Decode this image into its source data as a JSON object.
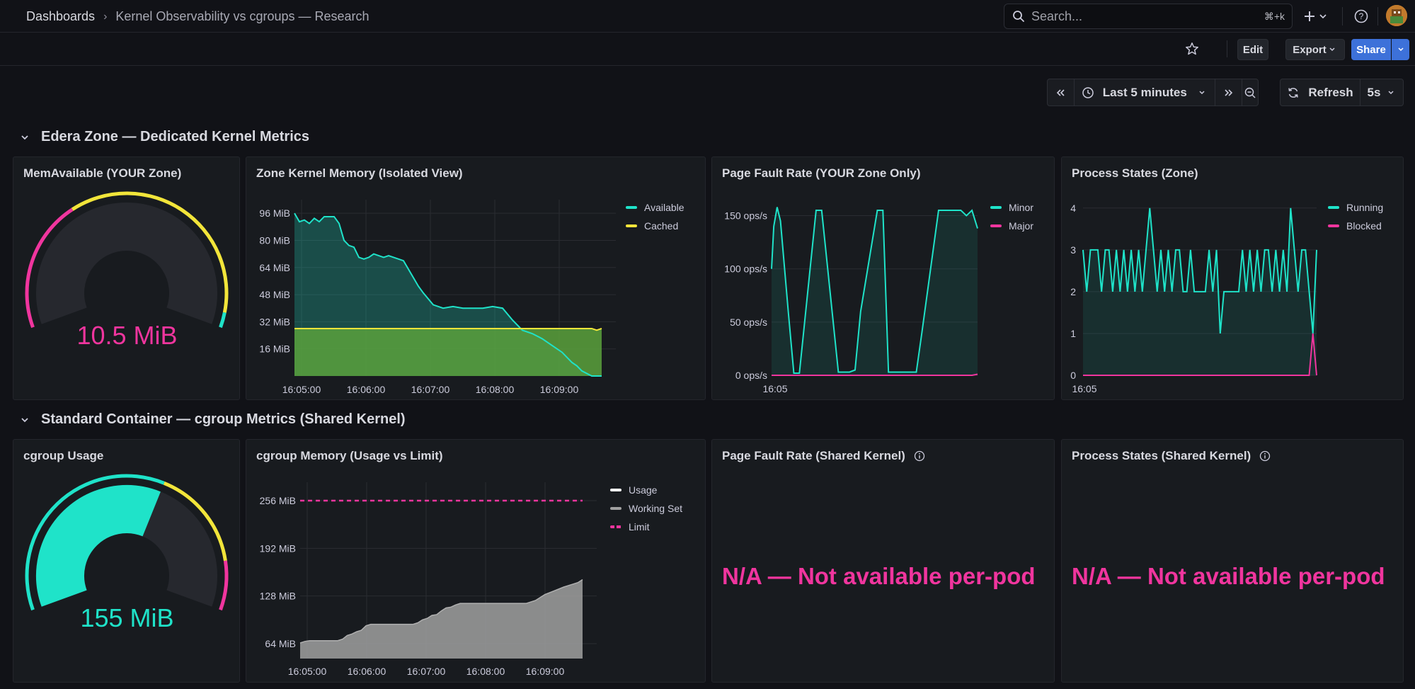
{
  "breadcrumb": {
    "home": "Dashboards",
    "separator": "›",
    "current": "Kernel Observability vs cgroups — Research"
  },
  "search": {
    "placeholder": "Search...",
    "shortcut": "⌘+k"
  },
  "toolbar": {
    "edit_label": "Edit",
    "export_label": "Export",
    "share_label": "Share"
  },
  "timepicker": {
    "range_label": "Last 5 minutes",
    "refresh_label": "Refresh",
    "interval": "5s"
  },
  "colors": {
    "accent_blue": "#3d71d9",
    "green": "#1fe3c9",
    "yellow": "#f2e53a",
    "pink": "#f0359e",
    "white": "#ffffff",
    "gray": "#a0a0a0",
    "green_fill": "#5aa13c"
  },
  "rows": [
    {
      "title": "Edera Zone — Dedicated Kernel Metrics"
    },
    {
      "title": "Standard Container — cgroup Metrics (Shared Kernel)"
    }
  ],
  "panels": {
    "mem_available": {
      "title": "MemAvailable (YOUR Zone)",
      "value": "10.5 MiB",
      "value_color": "#f0359e",
      "gauge_fraction": 0.04
    },
    "zone_kernel_memory": {
      "title": "Zone Kernel Memory (Isolated View)",
      "legend": [
        "Available",
        "Cached"
      ]
    },
    "page_fault_zone": {
      "title": "Page Fault Rate (YOUR Zone Only)",
      "legend": [
        "Minor",
        "Major"
      ]
    },
    "process_states_zone": {
      "title": "Process States (Zone)",
      "legend": [
        "Running",
        "Blocked"
      ]
    },
    "cgroup_usage": {
      "title": "cgroup Usage",
      "value": "155 MiB",
      "value_color": "#1fe3c9",
      "gauge_fraction": 0.6
    },
    "cgroup_memory": {
      "title": "cgroup Memory (Usage vs Limit)",
      "legend": [
        "Usage",
        "Working Set",
        "Limit"
      ]
    },
    "page_fault_shared": {
      "title": "Page Fault Rate (Shared Kernel)",
      "message": "N/A — Not available per-pod"
    },
    "process_states_shared": {
      "title": "Process States (Shared Kernel)",
      "message": "N/A — Not available per-pod"
    }
  },
  "chart_data": [
    {
      "id": "zone_kernel_memory",
      "type": "area",
      "x_ticks": [
        "16:05:00",
        "16:06:00",
        "16:07:00",
        "16:08:00",
        "16:09:00"
      ],
      "y_ticks": [
        "16 MiB",
        "32 MiB",
        "48 MiB",
        "64 MiB",
        "80 MiB",
        "96 MiB"
      ],
      "ylim": [
        0,
        104
      ],
      "xlim": [
        0,
        310
      ],
      "series": [
        {
          "name": "Available",
          "color": "#1fe3c9",
          "x": [
            0,
            5,
            10,
            15,
            20,
            25,
            30,
            40,
            45,
            50,
            55,
            60,
            65,
            70,
            75,
            80,
            90,
            95,
            100,
            110,
            115,
            120,
            125,
            130,
            140,
            150,
            160,
            170,
            180,
            190,
            200,
            210,
            220,
            230,
            240,
            250,
            260,
            270,
            275,
            280,
            285,
            290,
            300,
            310
          ],
          "y": [
            96,
            91,
            92,
            90,
            93,
            91,
            94,
            94,
            90,
            80,
            77,
            76,
            70,
            69,
            70,
            72,
            70,
            71,
            70,
            68,
            63,
            58,
            53,
            49,
            42,
            40,
            41,
            40,
            40,
            40,
            41,
            40,
            33,
            27,
            25,
            22,
            18,
            14,
            11,
            8,
            6,
            3,
            0,
            0
          ]
        },
        {
          "name": "Cached",
          "color": "#f2e53a",
          "x": [
            0,
            300,
            305,
            310
          ],
          "y": [
            28,
            28,
            27,
            28
          ]
        }
      ]
    },
    {
      "id": "page_fault_zone",
      "type": "line",
      "x_ticks": [
        "16:05"
      ],
      "y_ticks": [
        "0 ops/s",
        "50 ops/s",
        "100 ops/s",
        "150 ops/s"
      ],
      "ylim": [
        0,
        165
      ],
      "series": [
        {
          "name": "Minor",
          "color": "#1fe3c9",
          "x": [
            0,
            2,
            5,
            8,
            15,
            20,
            25,
            40,
            45,
            60,
            70,
            75,
            80,
            95,
            100,
            105,
            120,
            130,
            135,
            150,
            155,
            160,
            170,
            175,
            180,
            185
          ],
          "y": [
            100,
            140,
            158,
            145,
            60,
            2,
            2,
            155,
            155,
            3,
            3,
            5,
            60,
            155,
            155,
            3,
            3,
            3,
            40,
            155,
            155,
            155,
            155,
            150,
            155,
            138
          ]
        },
        {
          "name": "Major",
          "color": "#f0359e",
          "x": [
            0,
            180,
            185
          ],
          "y": [
            0,
            0,
            1
          ]
        }
      ]
    },
    {
      "id": "process_states_zone",
      "type": "line",
      "x_ticks": [
        "16:05"
      ],
      "y_ticks": [
        "0",
        "1",
        "2",
        "3",
        "4"
      ],
      "ylim": [
        0,
        4.2
      ],
      "series": [
        {
          "name": "Running",
          "color": "#1fe3c9",
          "y": [
            3,
            2,
            3,
            3,
            3,
            2,
            3,
            3,
            2,
            3,
            2,
            3,
            2,
            3,
            2,
            3,
            2,
            3,
            4,
            3,
            2,
            3,
            2,
            3,
            2,
            3,
            3,
            2,
            2,
            3,
            2,
            2,
            2,
            2,
            3,
            2,
            3,
            1,
            2,
            2,
            2,
            2,
            2,
            3,
            2,
            3,
            2,
            3,
            2,
            3,
            3,
            2,
            3,
            2,
            3,
            2,
            4,
            3,
            2,
            3,
            3,
            2,
            1,
            3
          ]
        },
        {
          "name": "Blocked",
          "color": "#f0359e",
          "y": [
            0,
            0,
            0,
            0,
            0,
            0,
            0,
            0,
            0,
            0,
            0,
            0,
            0,
            0,
            0,
            0,
            0,
            0,
            0,
            0,
            0,
            0,
            0,
            0,
            0,
            0,
            0,
            0,
            0,
            0,
            0,
            0,
            0,
            0,
            0,
            0,
            0,
            0,
            0,
            0,
            0,
            0,
            0,
            0,
            0,
            0,
            0,
            0,
            0,
            0,
            0,
            0,
            0,
            0,
            0,
            0,
            0,
            0,
            0,
            0,
            0,
            0,
            1,
            0
          ]
        }
      ]
    },
    {
      "id": "cgroup_memory",
      "type": "area",
      "x_ticks": [
        "16:05:00",
        "16:06:00",
        "16:07:00",
        "16:08:00",
        "16:09:00"
      ],
      "y_ticks": [
        "64 MiB",
        "128 MiB",
        "192 MiB",
        "256 MiB"
      ],
      "ylim": [
        44,
        256
      ],
      "xlim": [
        0,
        300
      ],
      "series": [
        {
          "name": "Usage",
          "color": "#ffffff",
          "y": []
        },
        {
          "name": "Working Set",
          "color": "#a0a0a0",
          "x": [
            0,
            5,
            10,
            20,
            30,
            40,
            45,
            50,
            55,
            60,
            65,
            70,
            75,
            80,
            90,
            100,
            110,
            120,
            125,
            130,
            135,
            140,
            145,
            150,
            155,
            160,
            165,
            170,
            175,
            180,
            190,
            200,
            210,
            230,
            240,
            245,
            250,
            255,
            260,
            270,
            280,
            290,
            295,
            300
          ],
          "y": [
            65,
            67,
            68,
            68,
            68,
            68,
            70,
            75,
            77,
            80,
            82,
            88,
            90,
            90,
            90,
            90,
            90,
            90,
            92,
            96,
            98,
            102,
            103,
            108,
            112,
            113,
            116,
            118,
            118,
            118,
            118,
            118,
            118,
            118,
            118,
            120,
            122,
            126,
            130,
            135,
            140,
            144,
            146,
            150
          ]
        },
        {
          "name": "Limit",
          "color": "#f0359e",
          "x": [
            0,
            300
          ],
          "y": [
            256,
            256
          ]
        }
      ]
    }
  ]
}
